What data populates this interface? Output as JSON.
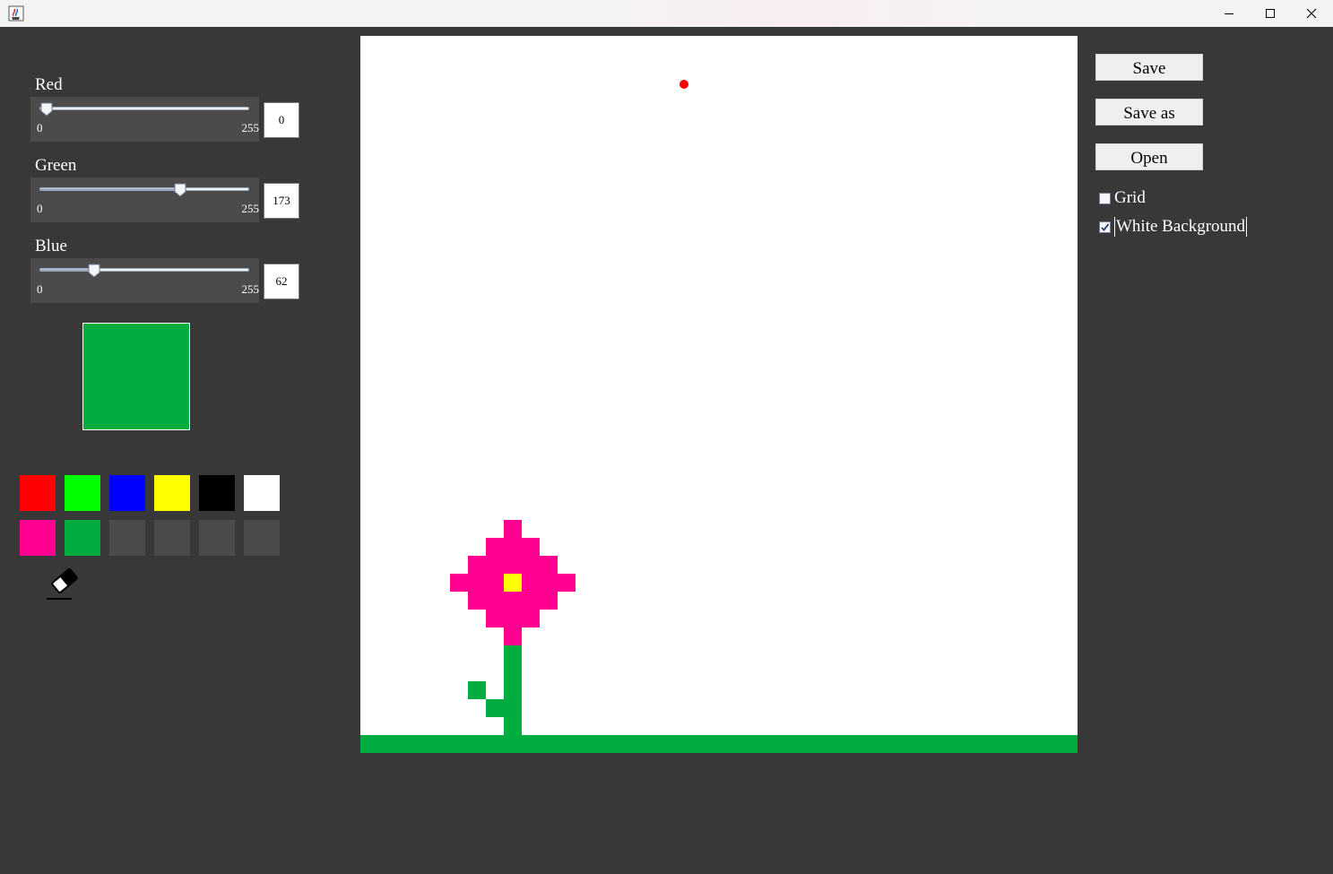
{
  "window": {
    "icon": "java-cup-icon",
    "controls": [
      "minimize-icon",
      "maximize-icon",
      "close-icon"
    ]
  },
  "sliders": [
    {
      "label": "Red",
      "min": "0",
      "max": "255",
      "value": "0",
      "fraction": 0.0
    },
    {
      "label": "Green",
      "min": "0",
      "max": "255",
      "value": "173",
      "fraction": 0.678
    },
    {
      "label": "Blue",
      "min": "0",
      "max": "255",
      "value": "62",
      "fraction": 0.243
    }
  ],
  "current_color": "#00ad3e",
  "palette": {
    "row1": [
      "#ff0000",
      "#00ff00",
      "#0000ff",
      "#ffff00",
      "#000000",
      "#ffffff"
    ],
    "row2": [
      "#ff0090",
      "#00ad3e",
      "#4b4b4b",
      "#4b4b4b",
      "#4b4b4b",
      "#4b4b4b"
    ]
  },
  "tools": {
    "eraser_icon": "eraser-icon"
  },
  "canvas": {
    "background": "#ffffff",
    "grid_cell": "20px",
    "colors": {
      "pink": "#ff0090",
      "yellow": "#ffff00",
      "green": "#00ad3e"
    }
  },
  "buttons": {
    "save": "Save",
    "save_as": "Save as",
    "open": "Open"
  },
  "options": {
    "grid": {
      "label": "Grid",
      "checked": false
    },
    "white_background": {
      "label": "White Background",
      "checked": true
    }
  }
}
